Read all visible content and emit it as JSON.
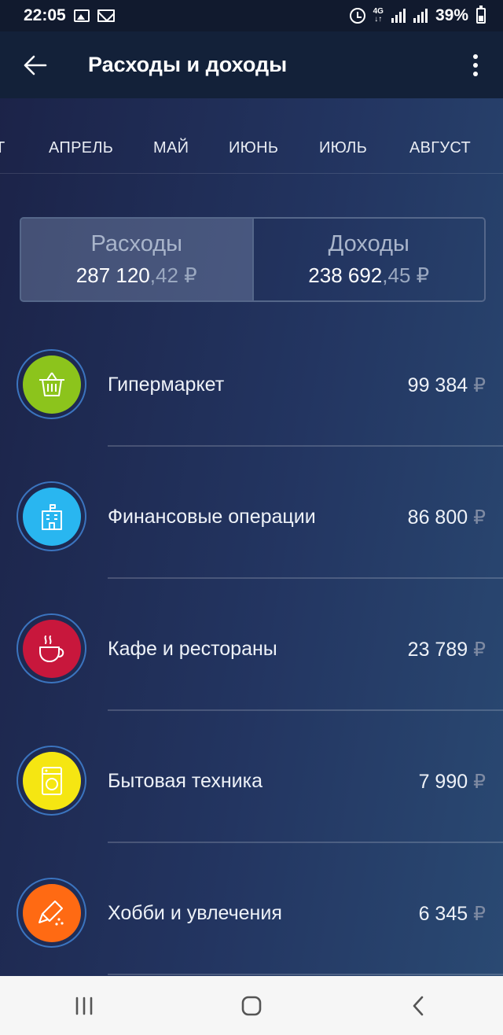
{
  "status_bar": {
    "time": "22:05",
    "battery": "39%",
    "network": "4G"
  },
  "app_bar": {
    "title": "Расходы и доходы"
  },
  "months": {
    "items": [
      "Т",
      "АПРЕЛЬ",
      "МАЙ",
      "ИЮНЬ",
      "ИЮЛЬ",
      "АВГУСТ"
    ]
  },
  "summary": {
    "expenses": {
      "label": "Расходы",
      "amount_int": "287 120",
      "amount_dec": ",42",
      "currency": "₽",
      "active": true
    },
    "income": {
      "label": "Доходы",
      "amount_int": "238 692",
      "amount_dec": ",45",
      "currency": "₽",
      "active": false
    }
  },
  "categories": [
    {
      "name": "Гипермаркет",
      "amount": "99 384",
      "currency": "₽",
      "icon": "basket-icon",
      "color": "#8cc41c"
    },
    {
      "name": "Финансовые операции",
      "amount": "86 800",
      "currency": "₽",
      "icon": "bank-building-icon",
      "color": "#29b6f0"
    },
    {
      "name": "Кафе и рестораны",
      "amount": "23 789",
      "currency": "₽",
      "icon": "coffee-cup-icon",
      "color": "#c8173c"
    },
    {
      "name": "Бытовая техника",
      "amount": "7 990",
      "currency": "₽",
      "icon": "washing-machine-icon",
      "color": "#f5e612"
    },
    {
      "name": "Хобби и увлечения",
      "amount": "6 345",
      "currency": "₽",
      "icon": "paint-tube-icon",
      "color": "#ff6a13"
    }
  ],
  "colors": {
    "app_bar": "#132139",
    "status_bar": "#111a2e",
    "ring": "#3b74bf",
    "nav_bar": "#f6f6f6"
  }
}
